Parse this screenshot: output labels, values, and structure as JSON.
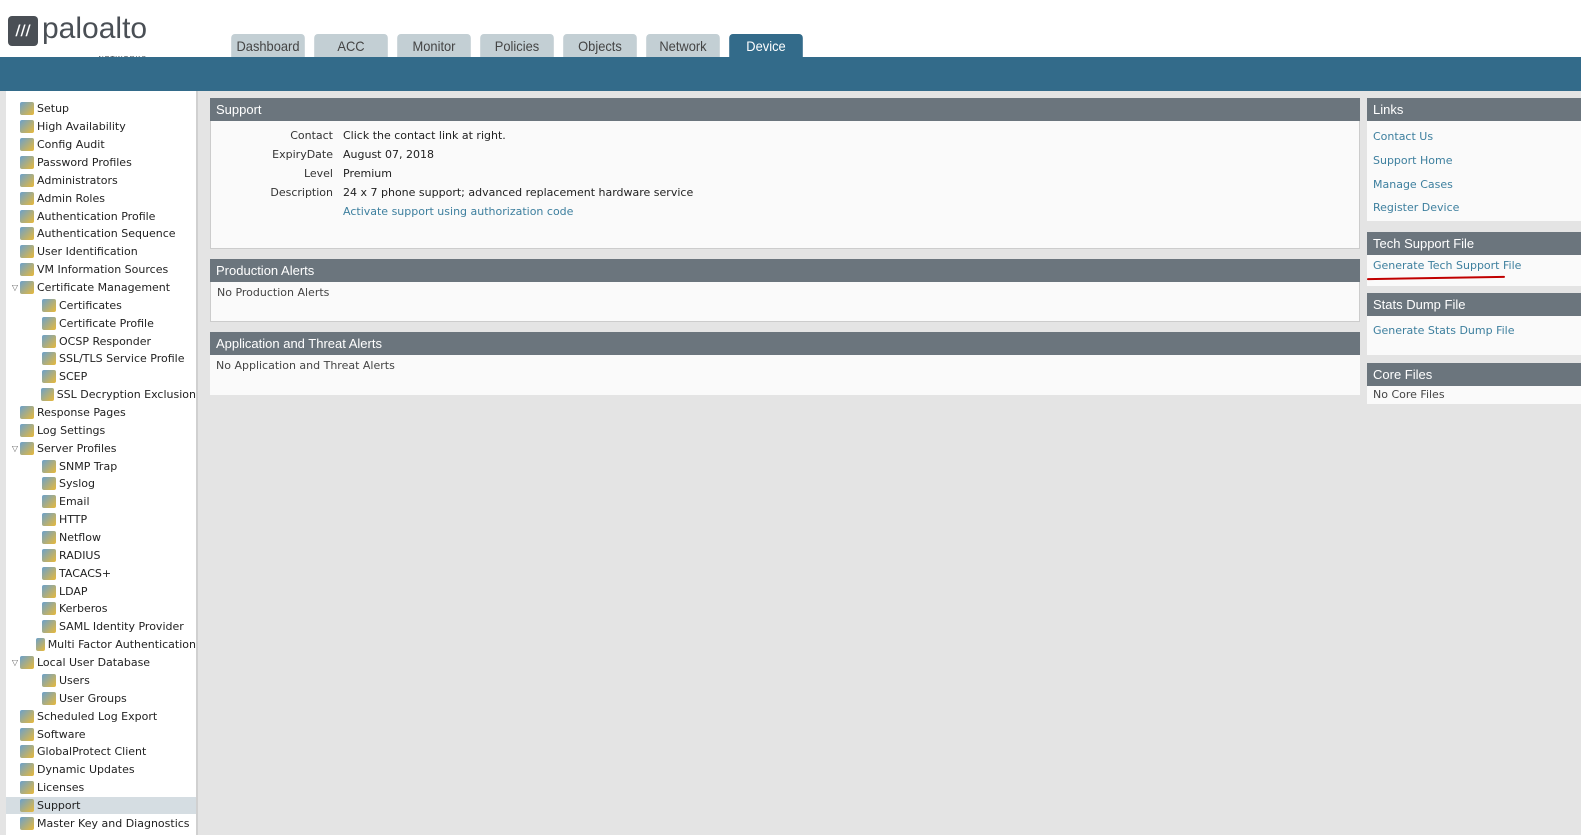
{
  "brand": {
    "name": "paloalto",
    "sub": "NETWORKS"
  },
  "tabs": [
    "Dashboard",
    "ACC",
    "Monitor",
    "Policies",
    "Objects",
    "Network",
    "Device"
  ],
  "active_tab": "Device",
  "sidebar": [
    {
      "label": "Setup",
      "level": 0
    },
    {
      "label": "High Availability",
      "level": 0
    },
    {
      "label": "Config Audit",
      "level": 0
    },
    {
      "label": "Password Profiles",
      "level": 0
    },
    {
      "label": "Administrators",
      "level": 0
    },
    {
      "label": "Admin Roles",
      "level": 0
    },
    {
      "label": "Authentication Profile",
      "level": 0
    },
    {
      "label": "Authentication Sequence",
      "level": 0
    },
    {
      "label": "User Identification",
      "level": 0
    },
    {
      "label": "VM Information Sources",
      "level": 0
    },
    {
      "label": "Certificate Management",
      "level": 0,
      "expanded": true
    },
    {
      "label": "Certificates",
      "level": 1
    },
    {
      "label": "Certificate Profile",
      "level": 1
    },
    {
      "label": "OCSP Responder",
      "level": 1
    },
    {
      "label": "SSL/TLS Service Profile",
      "level": 1
    },
    {
      "label": "SCEP",
      "level": 1
    },
    {
      "label": "SSL Decryption Exclusion",
      "level": 1
    },
    {
      "label": "Response Pages",
      "level": 0
    },
    {
      "label": "Log Settings",
      "level": 0
    },
    {
      "label": "Server Profiles",
      "level": 0,
      "expanded": true
    },
    {
      "label": "SNMP Trap",
      "level": 1
    },
    {
      "label": "Syslog",
      "level": 1
    },
    {
      "label": "Email",
      "level": 1
    },
    {
      "label": "HTTP",
      "level": 1
    },
    {
      "label": "Netflow",
      "level": 1
    },
    {
      "label": "RADIUS",
      "level": 1
    },
    {
      "label": "TACACS+",
      "level": 1
    },
    {
      "label": "LDAP",
      "level": 1
    },
    {
      "label": "Kerberos",
      "level": 1
    },
    {
      "label": "SAML Identity Provider",
      "level": 1
    },
    {
      "label": "Multi Factor Authentication",
      "level": 1
    },
    {
      "label": "Local User Database",
      "level": 0,
      "expanded": true
    },
    {
      "label": "Users",
      "level": 1
    },
    {
      "label": "User Groups",
      "level": 1
    },
    {
      "label": "Scheduled Log Export",
      "level": 0
    },
    {
      "label": "Software",
      "level": 0
    },
    {
      "label": "GlobalProtect Client",
      "level": 0
    },
    {
      "label": "Dynamic Updates",
      "level": 0
    },
    {
      "label": "Licenses",
      "level": 0
    },
    {
      "label": "Support",
      "level": 0,
      "selected": true
    },
    {
      "label": "Master Key and Diagnostics",
      "level": 0
    }
  ],
  "support": {
    "title": "Support",
    "rows": [
      {
        "k": "Contact",
        "v": "Click the contact link at right."
      },
      {
        "k": "ExpiryDate",
        "v": "August 07, 2018"
      },
      {
        "k": "Level",
        "v": "Premium"
      },
      {
        "k": "Description",
        "v": "24 x 7 phone support; advanced replacement hardware service"
      }
    ],
    "activate_link": "Activate support using authorization code"
  },
  "production_alerts": {
    "title": "Production Alerts",
    "text": "No Production Alerts"
  },
  "threat_alerts": {
    "title": "Application and Threat Alerts",
    "text": "No Application and Threat Alerts"
  },
  "links": {
    "title": "Links",
    "items": [
      "Contact Us",
      "Support Home",
      "Manage Cases",
      "Register Device"
    ]
  },
  "tech_support": {
    "title": "Tech Support File",
    "link": "Generate Tech Support File"
  },
  "stats_dump": {
    "title": "Stats Dump File",
    "link": "Generate Stats Dump File"
  },
  "core_files": {
    "title": "Core Files",
    "text": "No Core Files"
  },
  "colors": {
    "nav_bar": "#336b8a",
    "panel_header": "#6b757d",
    "link": "#3d7f9e",
    "annotation": "#c00000"
  }
}
